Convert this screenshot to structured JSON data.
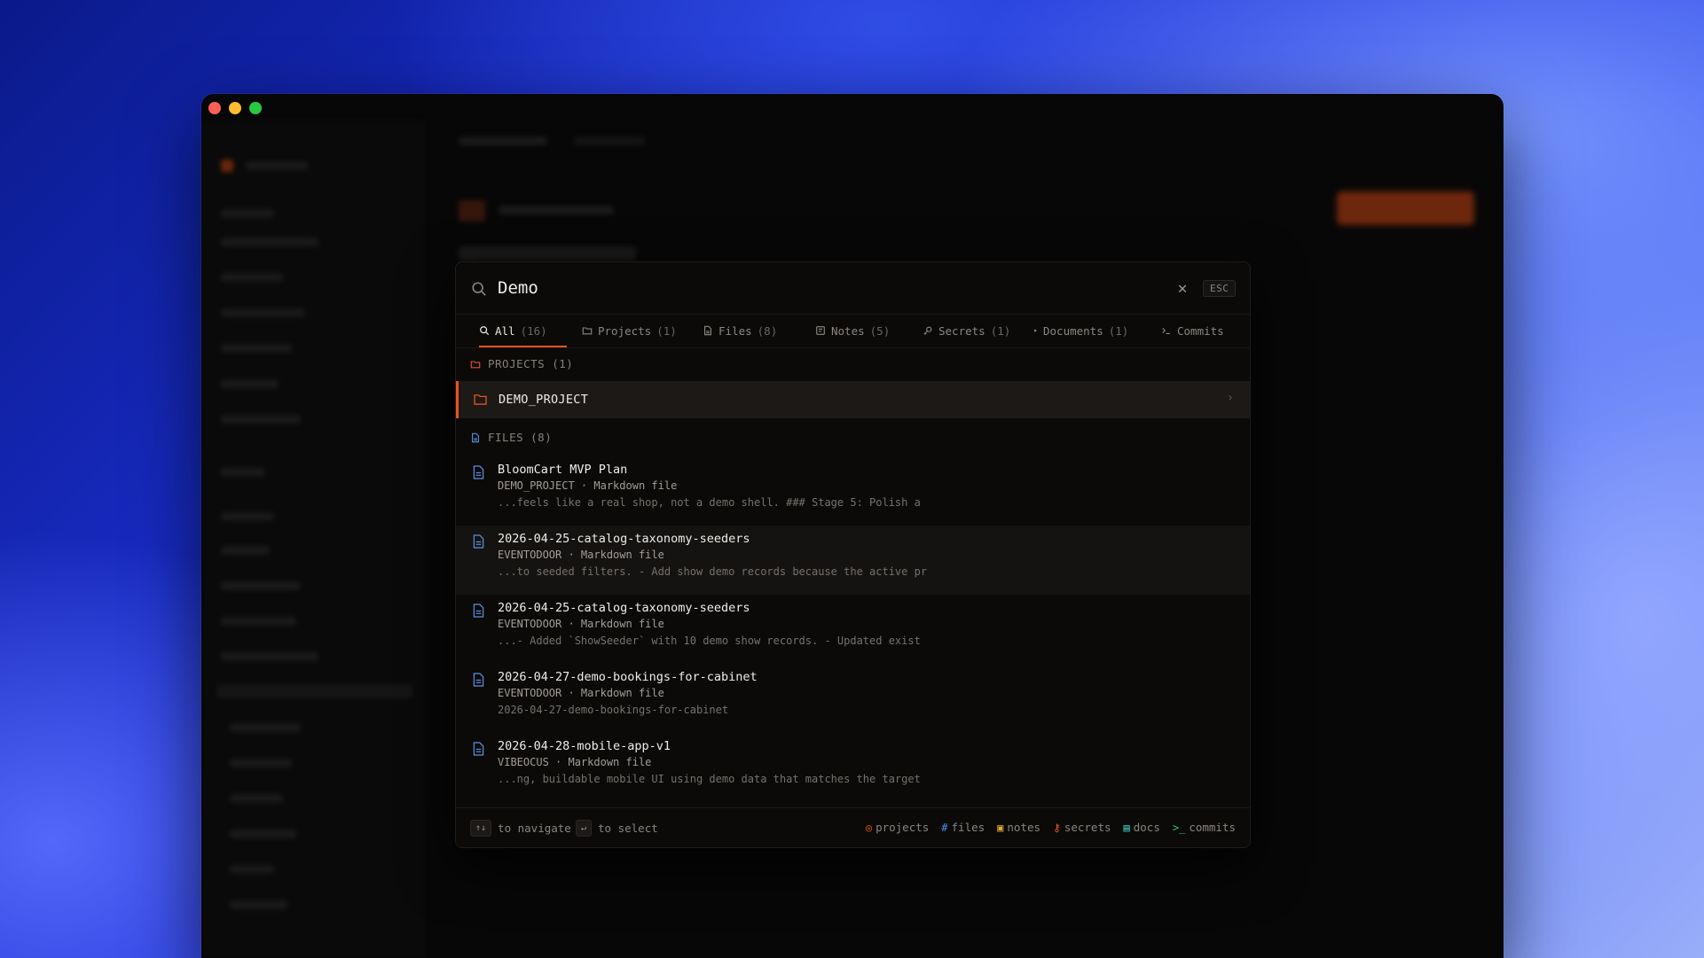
{
  "search": {
    "query": "Demo",
    "esc_label": "ESC",
    "clear_glyph": "✕"
  },
  "tabs": [
    {
      "label": "All",
      "count": "(16)",
      "icon": "search-icon",
      "active": true
    },
    {
      "label": "Projects",
      "count": "(1)",
      "icon": "folder-icon"
    },
    {
      "label": "Files",
      "count": "(8)",
      "icon": "file-icon"
    },
    {
      "label": "Notes",
      "count": "(5)",
      "icon": "note-icon"
    },
    {
      "label": "Secrets",
      "count": "(1)",
      "icon": "key-icon"
    },
    {
      "label": "Documents",
      "count": "(1)",
      "icon": "dot-icon"
    },
    {
      "label": "Commits",
      "count": "",
      "icon": "terminal-icon"
    }
  ],
  "sections": {
    "projects_label": "PROJECTS (1)",
    "files_label": "FILES (8)"
  },
  "projects": [
    {
      "name": "DEMO_PROJECT",
      "chevron": "›"
    }
  ],
  "files": [
    {
      "title": "BloomCart MVP Plan",
      "meta": "DEMO_PROJECT · Markdown file",
      "snippet": "...feels like a real shop, not a demo shell. ### Stage 5: Polish a"
    },
    {
      "title": "2026-04-25-catalog-taxonomy-seeders",
      "meta": "EVENTODOOR · Markdown file",
      "snippet": "...to seeded filters. - Add show demo records because the active pr"
    },
    {
      "title": "2026-04-25-catalog-taxonomy-seeders",
      "meta": "EVENTODOOR · Markdown file",
      "snippet": "...- Added `ShowSeeder` with 10 demo show records. - Updated exist"
    },
    {
      "title": "2026-04-27-demo-bookings-for-cabinet",
      "meta": "EVENTODOOR · Markdown file",
      "snippet": "2026-04-27-demo-bookings-for-cabinet"
    },
    {
      "title": "2026-04-28-mobile-app-v1",
      "meta": "VIBEOCUS · Markdown file",
      "snippet": "...ng, buildable mobile UI using demo data that matches the target"
    }
  ],
  "footer": {
    "navigate_key": "↑↓",
    "navigate_label": "to navigate",
    "select_key": "↵",
    "select_label": "to select",
    "legend": [
      {
        "glyph": "◎",
        "label": "projects",
        "color": "#e8541a"
      },
      {
        "glyph": "#",
        "label": "files",
        "color": "#4f8fe8"
      },
      {
        "glyph": "▣",
        "label": "notes",
        "color": "#e0a82e"
      },
      {
        "glyph": "⚷",
        "label": "secrets",
        "color": "#e8541a"
      },
      {
        "glyph": "▤",
        "label": "docs",
        "color": "#3cc8c0"
      },
      {
        "glyph": ">_",
        "label": "commits",
        "color": "#3cc86a"
      }
    ]
  },
  "colors": {
    "accent": "#e8541a",
    "file_icon": "#5b8fe0",
    "panel_bg": "#0b0a09"
  }
}
